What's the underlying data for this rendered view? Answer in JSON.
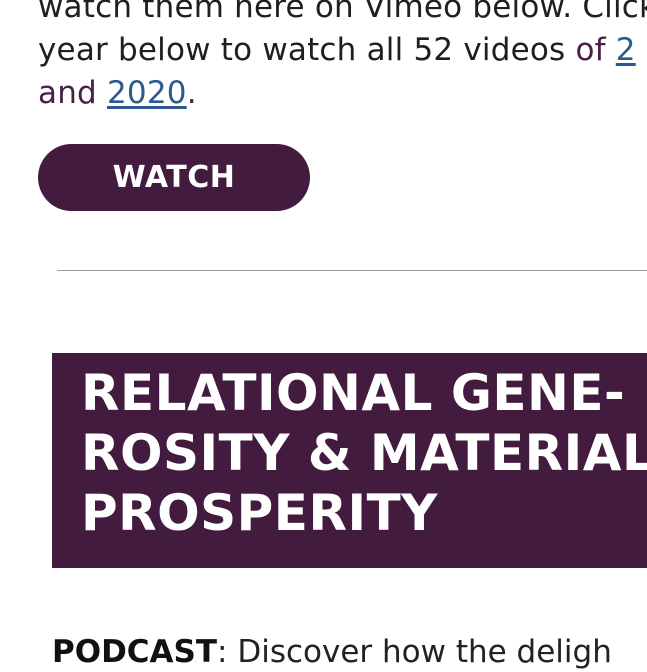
{
  "intro": {
    "line1": "watch them here on Vimeo below. Click",
    "line2_pre": "year below to watch all 52 videos ",
    "line2_of": "of ",
    "line2_link": "2",
    "line3_and": "and ",
    "line3_link": "2020",
    "line3_post": "."
  },
  "watch_button": {
    "label": "WATCH"
  },
  "section": {
    "heading_line1": "RELATIONAL GENE-",
    "heading_line2": "ROSITY & MATERIAL",
    "heading_line3": "PROSPERITY"
  },
  "podcast": {
    "label": "PODCAST",
    "text": ": Discover how the deligh"
  },
  "colors": {
    "brand_purple": "#431b3f",
    "link_blue": "#2c5a8c",
    "divider": "#9a9a9a"
  }
}
